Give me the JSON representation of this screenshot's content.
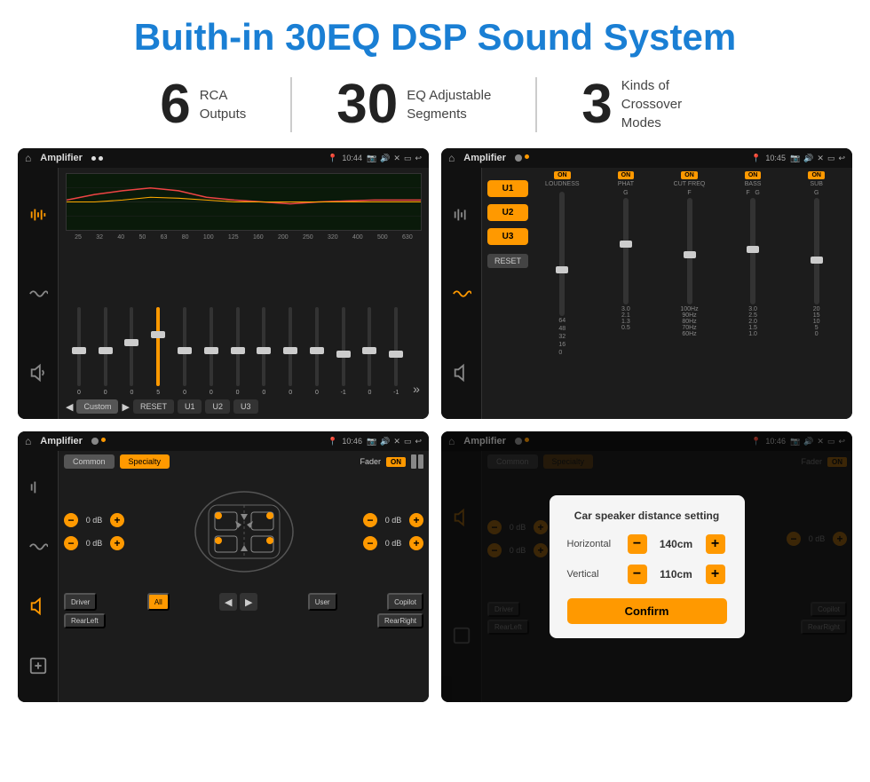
{
  "header": {
    "title": "Buith-in 30EQ DSP Sound System"
  },
  "specs": [
    {
      "number": "6",
      "line1": "RCA",
      "line2": "Outputs"
    },
    {
      "number": "30",
      "line1": "EQ Adjustable",
      "line2": "Segments"
    },
    {
      "number": "3",
      "line1": "Kinds of",
      "line2": "Crossover Modes"
    }
  ],
  "screens": [
    {
      "id": "eq-screen",
      "statusBar": {
        "appTitle": "Amplifier",
        "time": "10:44"
      },
      "freqLabels": [
        "25",
        "32",
        "40",
        "50",
        "63",
        "80",
        "100",
        "125",
        "160",
        "200",
        "250",
        "320",
        "400",
        "500",
        "630"
      ],
      "sliderValues": [
        "0",
        "0",
        "0",
        "5",
        "0",
        "0",
        "0",
        "0",
        "0",
        "0",
        "-1",
        "0",
        "-1"
      ],
      "bottomButtons": [
        "Custom",
        "RESET",
        "U1",
        "U2",
        "U3"
      ]
    },
    {
      "id": "crossover-screen",
      "statusBar": {
        "appTitle": "Amplifier",
        "time": "10:45"
      },
      "uButtons": [
        "U1",
        "U2",
        "U3"
      ],
      "channels": [
        {
          "name": "LOUDNESS",
          "on": true
        },
        {
          "name": "PHAT",
          "on": true
        },
        {
          "name": "CUT FREQ",
          "on": true
        },
        {
          "name": "BASS",
          "on": true
        },
        {
          "name": "SUB",
          "on": true
        }
      ],
      "resetBtn": "RESET"
    },
    {
      "id": "speaker-screen",
      "statusBar": {
        "appTitle": "Amplifier",
        "time": "10:46"
      },
      "tabs": [
        "Common",
        "Specialty"
      ],
      "activeTab": "Specialty",
      "faderLabel": "Fader",
      "faderOn": "ON",
      "volumeRows": [
        {
          "value": "0 dB"
        },
        {
          "value": "0 dB"
        },
        {
          "value": "0 dB"
        },
        {
          "value": "0 dB"
        }
      ],
      "bottomButtons": [
        "Driver",
        "All",
        "User",
        "Copilot",
        "RearLeft",
        "RearRight"
      ]
    },
    {
      "id": "distance-screen",
      "statusBar": {
        "appTitle": "Amplifier",
        "time": "10:46"
      },
      "dialog": {
        "title": "Car speaker distance setting",
        "horizontal": {
          "label": "Horizontal",
          "value": "140cm"
        },
        "vertical": {
          "label": "Vertical",
          "value": "110cm"
        },
        "confirmBtn": "Confirm"
      },
      "volumeRows": [
        {
          "value": "0 dB"
        },
        {
          "value": "0 dB"
        }
      ],
      "bottomButtons": [
        "Driver",
        "Copilot",
        "RearLeft",
        "RearRight"
      ]
    }
  ]
}
